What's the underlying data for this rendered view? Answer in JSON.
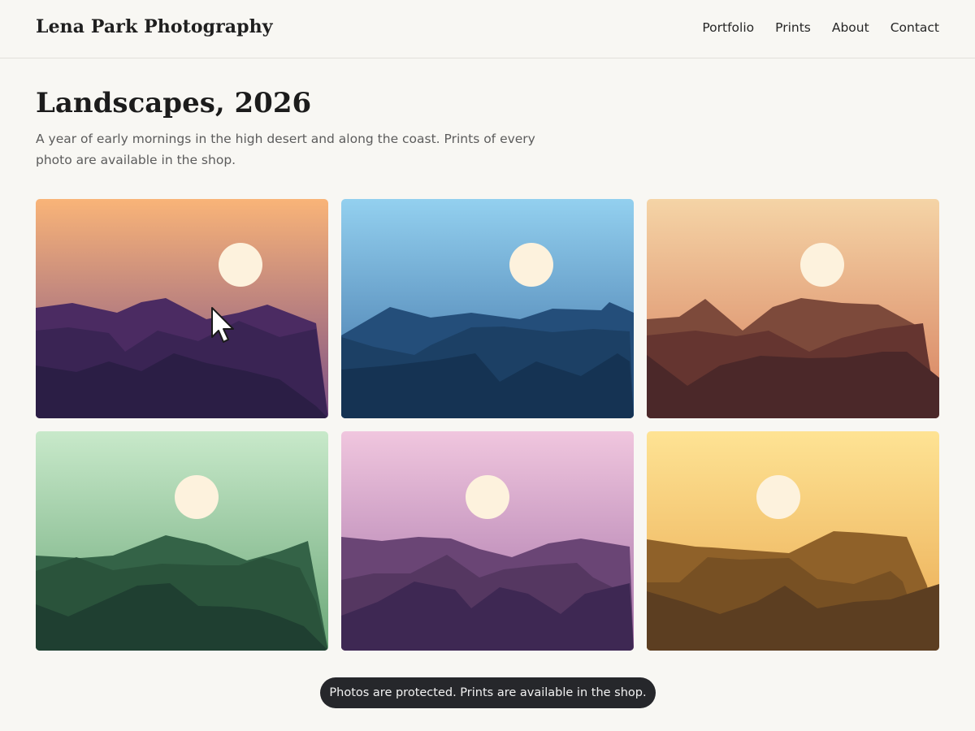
{
  "site": {
    "brand": "Lena Park Photography"
  },
  "nav": {
    "items": [
      {
        "label": "Portfolio"
      },
      {
        "label": "Prints"
      },
      {
        "label": "About"
      },
      {
        "label": "Contact"
      }
    ]
  },
  "page": {
    "title": "Landscapes, 2026",
    "intro": "A year of early mornings in the high desert and along the coast. Prints of every photo are available in the shop."
  },
  "gallery": {
    "photos": [
      {
        "theme": "dusk",
        "sky_top": "#f9b478",
        "sky_bottom": "#7c4f86",
        "ridges": [
          "#4b2b62",
          "#3a2454",
          "#2b1e45"
        ],
        "sun": "#fdf2dd"
      },
      {
        "theme": "blue-hour",
        "sky_top": "#93d0ef",
        "sky_bottom": "#3d6fa4",
        "ridges": [
          "#244e7a",
          "#1c4065",
          "#153353"
        ],
        "sun": "#fdf2dd"
      },
      {
        "theme": "desert-sunset",
        "sky_top": "#f5d4a6",
        "sky_bottom": "#d67f5e",
        "ridges": [
          "#7d4a3b",
          "#653530",
          "#4b2829"
        ],
        "sun": "#fdf2dd"
      },
      {
        "theme": "green-hills",
        "sky_top": "#c8e9ca",
        "sky_bottom": "#6ba778",
        "ridges": [
          "#346347",
          "#2a533b",
          "#1f3f31"
        ],
        "sun": "#fdf2dd"
      },
      {
        "theme": "lavender-dawn",
        "sky_top": "#f0c6de",
        "sky_bottom": "#a572a8",
        "ridges": [
          "#6a4575",
          "#553761",
          "#3e2853"
        ],
        "sun": "#fdf2dd"
      },
      {
        "theme": "golden-hour",
        "sky_top": "#fee394",
        "sky_bottom": "#e9a850",
        "ridges": [
          "#8f6129",
          "#775023",
          "#5c3e21"
        ],
        "sun": "#fdf2dd"
      }
    ]
  },
  "toast": {
    "message": "Photos are protected. Prints are available in the shop."
  },
  "icons": {
    "cursor": "arrow-cursor-icon"
  }
}
